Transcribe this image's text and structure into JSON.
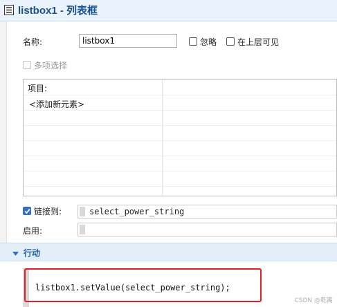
{
  "title": "listbox1 - 列表框",
  "props": {
    "name_label": "名称:",
    "name_value": "listbox1",
    "ignore_label": "忽略",
    "ontop_label": "在上层可见",
    "multiselect_label": "多项选择"
  },
  "listbox": {
    "header": "项目:",
    "items": [
      "<添加新元素>"
    ]
  },
  "linked": {
    "label": "链接到:",
    "checked": true,
    "value": "select_power_string"
  },
  "enable": {
    "label": "启用:",
    "value": ""
  },
  "actions": {
    "section_label": "行动",
    "code": "listbox1.setValue(select_power_string);"
  },
  "watermark": "CSDN @乾离",
  "colors": {
    "accent": "#2f6fc8",
    "highlight": "#e02020",
    "title": "#1b4f8c"
  }
}
